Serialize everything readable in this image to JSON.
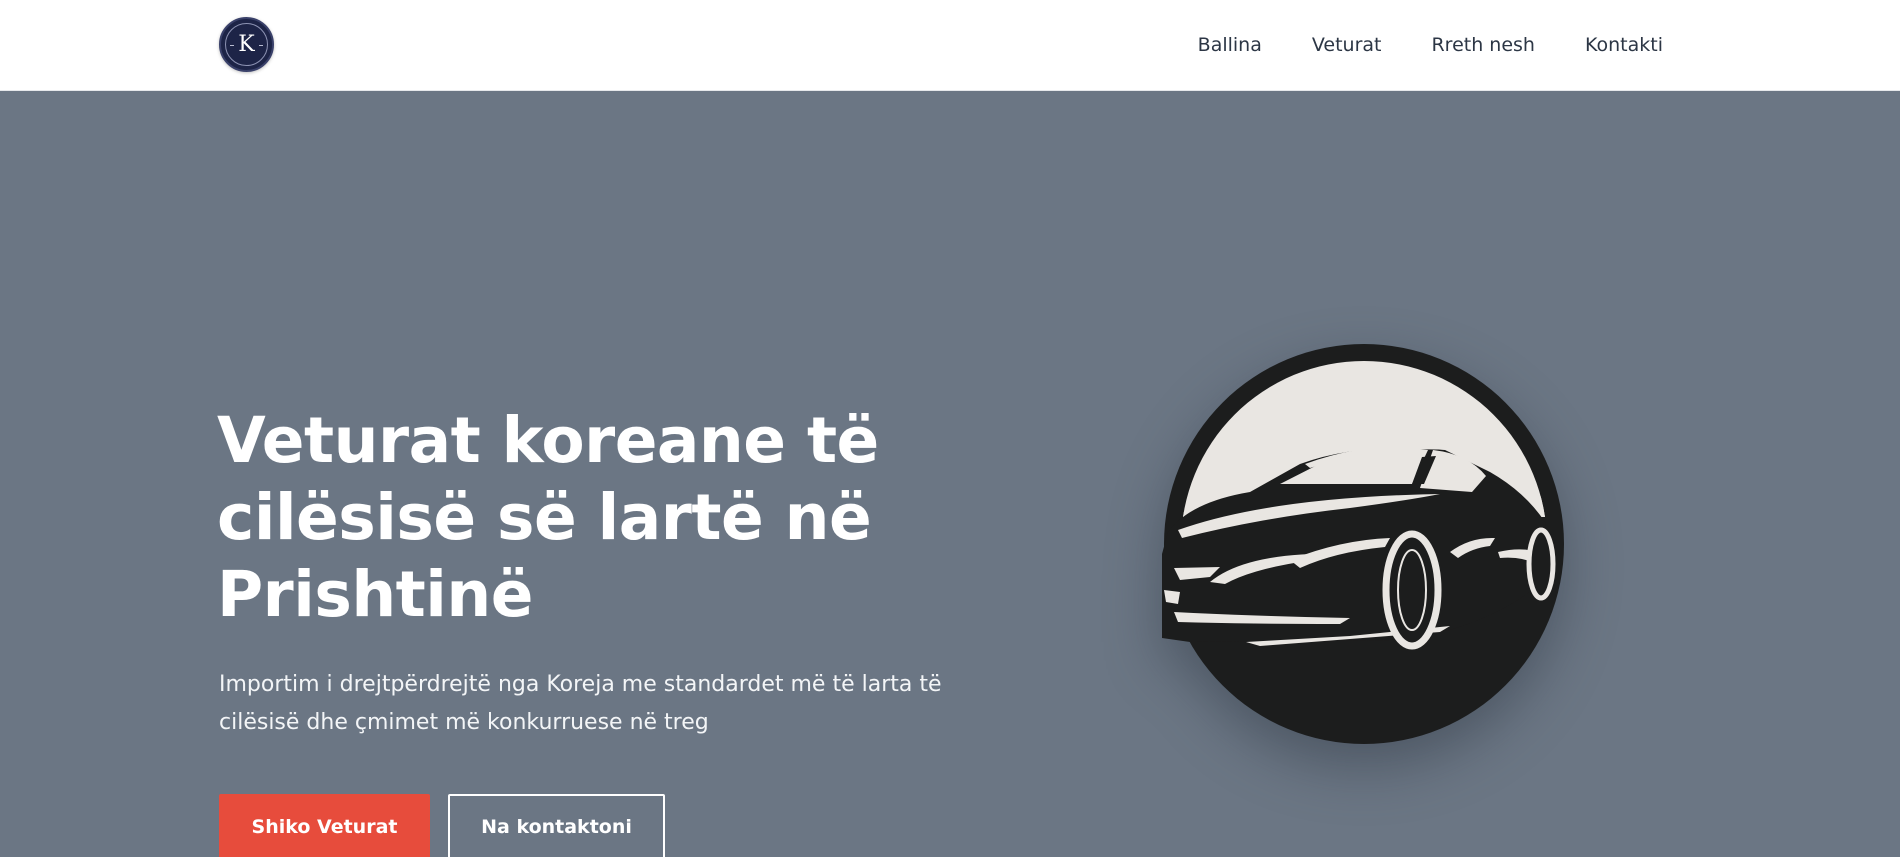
{
  "header": {
    "logo_letter": "K",
    "nav": [
      {
        "label": "Ballina"
      },
      {
        "label": "Veturat"
      },
      {
        "label": "Rreth nesh"
      },
      {
        "label": "Kontakti"
      }
    ]
  },
  "hero": {
    "title": "Veturat koreane të cilësisë së lartë në Prishtinë",
    "subtitle": "Importim i drejtpërdrejtë nga Koreja me standardet më të larta të cilësisë dhe çmimet më konkurruese në treg",
    "primary_button": "Shiko Veturat",
    "secondary_button": "Na kontaktoni",
    "emblem_icon": "car-emblem-icon"
  },
  "colors": {
    "hero_background": "#6b7684",
    "header_background": "#ffffff",
    "primary_accent": "#e74c3c",
    "logo_background": "#1d2447",
    "nav_text": "#2c3645"
  }
}
